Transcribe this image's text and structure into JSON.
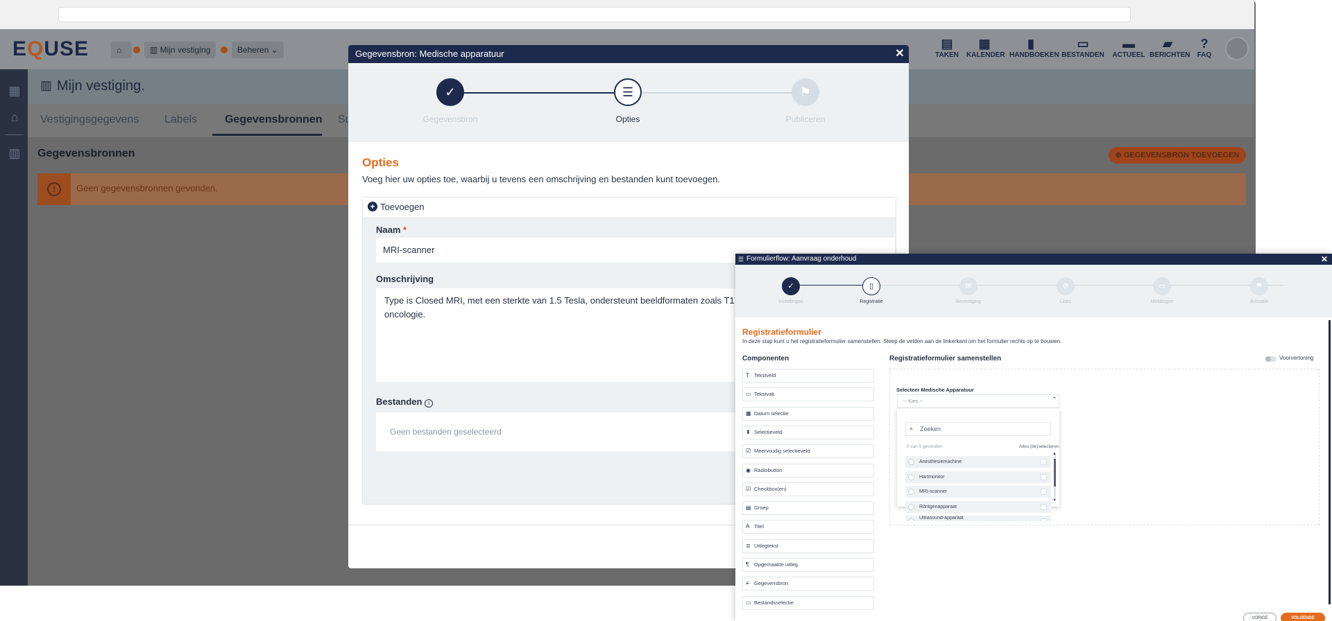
{
  "app": {
    "logo": {
      "pre": "E",
      "q": "Q",
      "post": "USE"
    },
    "breadcrumb": {
      "home_icon": "home-icon",
      "vestiging": "Mijn vestiging",
      "beheren": "Beheren"
    },
    "topnav": [
      {
        "label": "TAKEN",
        "icon": "clipboard-icon",
        "glyph": "▤"
      },
      {
        "label": "KALENDER",
        "icon": "calendar-icon",
        "glyph": "▦"
      },
      {
        "label": "HANDBOEKEN",
        "icon": "book-icon",
        "glyph": "▮"
      },
      {
        "label": "BESTANDEN",
        "icon": "archive-icon",
        "glyph": "▭"
      },
      {
        "label": "ACTUEEL",
        "icon": "newspaper-icon",
        "glyph": "▬"
      },
      {
        "label": "BERICHTEN",
        "icon": "chat-icon",
        "glyph": "▰"
      },
      {
        "label": "FAQ",
        "icon": "question-icon",
        "glyph": "?"
      }
    ]
  },
  "page": {
    "title": "Mijn vestiging.",
    "tabs": [
      "Vestigingsgegevens",
      "Labels",
      "Gegevensbronnen",
      "Su"
    ],
    "section_title": "Gegevensbronnen",
    "add_button": "GEGEVENSBRON TOEVOEGEN",
    "alert": "Geen gegevensbronnen gevonden."
  },
  "modal1": {
    "title": "Gegevensbron: Medische apparatuur",
    "steps": [
      "Gegevensbron",
      "Opties",
      "Publiceren"
    ],
    "section_title": "Opties",
    "section_desc": "Voeg hier uw opties toe, waarbij u tevens een omschrijving en bestanden kunt toevoegen.",
    "add_label": "Toevoegen",
    "name_label": "Naam",
    "required_mark": "*",
    "name_value": "MRI-scanner",
    "desc_label": "Omschrijving",
    "desc_value": "Type is Closed MRI, met een sterkte van 1.5 Tesla, ondersteunt beeldformaten zoals T1 in neurologie, orthopedie en oncologie.",
    "files_label": "Bestanden",
    "files_empty": "Geen bestanden geselecteerd"
  },
  "modal2": {
    "title": "Formulierflow: Aanvraag onderhoud",
    "steps": [
      "Instellingen",
      "Registratie",
      "Bevestiging",
      "Links",
      "Meldingen",
      "Activatie"
    ],
    "section_title": "Registratieformulier",
    "section_desc": "In deze stap kunt u het registratieformulier samenstellen. Sleep de velden aan de linkerkant om het formulier rechts op te bouwen.",
    "components_title": "Componenten",
    "components": [
      {
        "label": "Tekstveld",
        "icon": "text-field-icon",
        "glyph": "T"
      },
      {
        "label": "Tekstvak",
        "icon": "textarea-icon",
        "glyph": "▭"
      },
      {
        "label": "Datum selectie",
        "icon": "date-icon",
        "glyph": "▦"
      },
      {
        "label": "Selectieveld",
        "icon": "select-icon",
        "glyph": "⬍"
      },
      {
        "label": "Meervoudig selectieveld",
        "icon": "multiselect-icon",
        "glyph": "☑"
      },
      {
        "label": "Radiobutton",
        "icon": "radio-icon",
        "glyph": "◉"
      },
      {
        "label": "Checkbox(en)",
        "icon": "checkbox-icon",
        "glyph": "☑"
      },
      {
        "label": "Groep",
        "icon": "group-icon",
        "glyph": "▤"
      },
      {
        "label": "Titel",
        "icon": "title-icon",
        "glyph": "A"
      },
      {
        "label": "Uitlegtekst",
        "icon": "explanation-icon",
        "glyph": "≣"
      },
      {
        "label": "Opgemaakte uitleg",
        "icon": "paragraph-icon",
        "glyph": "¶"
      },
      {
        "label": "Gegevensbron",
        "icon": "database-icon",
        "glyph": "≡"
      },
      {
        "label": "Bestandsselectie",
        "icon": "monitor-icon",
        "glyph": "▭"
      }
    ],
    "build_title": "Registratieformulier samenstellen",
    "preview_label": "Voorvertoning",
    "select_label": "Selecteer Medische Apparatuur",
    "select_placeholder": "-- Kies --",
    "search_placeholder": "Zoeken",
    "found_text": "5 van 5 gevonden",
    "select_all": "Alles (de)selecteren",
    "options": [
      "Anesthesiemachine",
      "Hartmonitor",
      "MRI-scanner",
      "Röntgenapparaat",
      "Ultrasound-apparaat"
    ],
    "prev_button": "VORIGE",
    "next_button": "VOLGENDE"
  },
  "colors": {
    "accent": "#e56b1f",
    "navy": "#1e2a4d"
  }
}
